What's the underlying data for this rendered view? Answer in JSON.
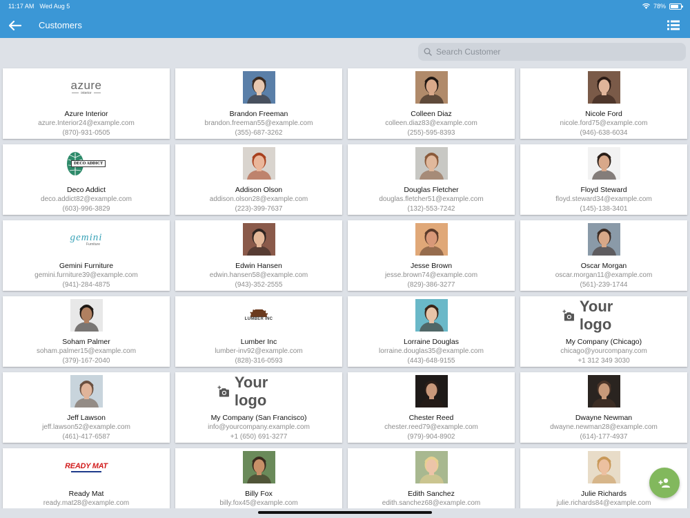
{
  "status": {
    "time": "11:17 AM",
    "date": "Wed Aug 5",
    "battery": "78%",
    "battery_level": 0.78
  },
  "nav": {
    "title": "Customers"
  },
  "search": {
    "placeholder": "Search Customer"
  },
  "logos": {
    "azure": {
      "main": "azure",
      "sub": "interior"
    },
    "deco": "DECO ADDICT",
    "gemini": {
      "main": "gemini",
      "sub": "Furniture"
    },
    "lumber": "LUMBER INC",
    "readymat": "READY MAT",
    "yourlogo": "Your logo"
  },
  "customers": [
    {
      "name": "Azure Interior",
      "email": "azure.Interior24@example.com",
      "phone": "(870)-931-0505",
      "image": "logo-azure"
    },
    {
      "name": "Brandon Freeman",
      "email": "brandon.freeman55@example.com",
      "phone": "(355)-687-3262",
      "image": "photo",
      "colors": [
        "#5a7fa8",
        "#e8c8b0",
        "#3a2a20"
      ]
    },
    {
      "name": "Colleen Diaz",
      "email": "colleen.diaz83@example.com",
      "phone": "(255)-595-8393",
      "image": "photo",
      "colors": [
        "#b08a6a",
        "#d9a98a",
        "#1e1612"
      ]
    },
    {
      "name": "Nicole Ford",
      "email": "nicole.ford75@example.com",
      "phone": "(946)-638-6034",
      "image": "photo",
      "colors": [
        "#7a5a48",
        "#e0b49a",
        "#2a1a14"
      ]
    },
    {
      "name": "Deco Addict",
      "email": "deco.addict82@example.com",
      "phone": "(603)-996-3829",
      "image": "logo-deco"
    },
    {
      "name": "Addison Olson",
      "email": "addison.olson28@example.com",
      "phone": "(223)-399-7637",
      "image": "photo",
      "colors": [
        "#d9d4ce",
        "#eab69a",
        "#a8401e"
      ]
    },
    {
      "name": "Douglas Fletcher",
      "email": "douglas.fletcher51@example.com",
      "phone": "(132)-553-7242",
      "image": "photo",
      "colors": [
        "#c8c8c4",
        "#e0b89c",
        "#8a5a3a"
      ]
    },
    {
      "name": "Floyd Steward",
      "email": "floyd.steward34@example.com",
      "phone": "(145)-138-3401",
      "image": "photo",
      "colors": [
        "#f2f2f2",
        "#d8a88a",
        "#2a1e18"
      ]
    },
    {
      "name": "Gemini Furniture",
      "email": "gemini.furniture39@example.com",
      "phone": "(941)-284-4875",
      "image": "logo-gemini"
    },
    {
      "name": "Edwin Hansen",
      "email": "edwin.hansen58@example.com",
      "phone": "(943)-352-2555",
      "image": "photo",
      "colors": [
        "#8a5a4a",
        "#e4b898",
        "#2e2420"
      ]
    },
    {
      "name": "Jesse Brown",
      "email": "jesse.brown74@example.com",
      "phone": "(829)-386-3277",
      "image": "photo",
      "colors": [
        "#e0a878",
        "#d89878",
        "#5a3a2a"
      ]
    },
    {
      "name": "Oscar Morgan",
      "email": "oscar.morgan11@example.com",
      "phone": "(561)-239-1744",
      "image": "photo",
      "colors": [
        "#8a9aa8",
        "#d8a888",
        "#3a2a22"
      ]
    },
    {
      "name": "Soham Palmer",
      "email": "soham.palmer15@example.com",
      "phone": "(379)-167-2040",
      "image": "photo",
      "colors": [
        "#e8e8e8",
        "#b08060",
        "#1e1814"
      ]
    },
    {
      "name": "Lumber Inc",
      "email": "lumber-inv92@example.com",
      "phone": "(828)-316-0593",
      "image": "logo-lumber"
    },
    {
      "name": "Lorraine Douglas",
      "email": "lorraine.douglas35@example.com",
      "phone": "(443)-648-9155",
      "image": "photo",
      "colors": [
        "#6ab8c8",
        "#e8c4a8",
        "#3a2418"
      ]
    },
    {
      "name": "My Company (Chicago)",
      "email": "chicago@yourcompany.com",
      "phone": "+1 312 349 3030",
      "image": "logo-your"
    },
    {
      "name": "Jeff Lawson",
      "email": "jeff.lawson52@example.com",
      "phone": "(461)-417-6587",
      "image": "photo",
      "colors": [
        "#c8d4dc",
        "#e0b49a",
        "#6a5040"
      ]
    },
    {
      "name": "My Company (San Francisco)",
      "email": "info@yourcompany.example.com",
      "phone": "+1 (650) 691-3277",
      "image": "logo-your"
    },
    {
      "name": "Chester Reed",
      "email": "chester.reed79@example.com",
      "phone": "(979)-904-8902",
      "image": "photo",
      "colors": [
        "#1e1a18",
        "#c8987a",
        "#2a1e18"
      ]
    },
    {
      "name": "Dwayne Newman",
      "email": "dwayne.newman28@example.com",
      "phone": "(614)-177-4937",
      "image": "photo",
      "colors": [
        "#2a2420",
        "#c89a7a",
        "#4a3428"
      ]
    },
    {
      "name": "Ready Mat",
      "email": "ready.mat28@example.com",
      "phone": "",
      "image": "logo-readymat"
    },
    {
      "name": "Billy Fox",
      "email": "billy.fox45@example.com",
      "phone": "",
      "image": "photo",
      "colors": [
        "#6a8a5a",
        "#c89068",
        "#3a2a1e"
      ]
    },
    {
      "name": "Edith Sanchez",
      "email": "edith.sanchez68@example.com",
      "phone": "",
      "image": "photo",
      "colors": [
        "#a8b890",
        "#ecc4a8",
        "#e8d090"
      ]
    },
    {
      "name": "Julie Richards",
      "email": "julie.richards84@example.com",
      "phone": "",
      "image": "photo",
      "colors": [
        "#e8dcc8",
        "#ecc0a0",
        "#c89858"
      ]
    }
  ]
}
